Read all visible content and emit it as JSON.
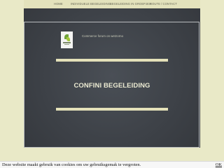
{
  "nav": {
    "items": [
      {
        "label": "HOME"
      },
      {
        "label": "INDIVIDUELE BEGELEIDING"
      },
      {
        "label": "BEGELEIDING IN GROEPJES"
      },
      {
        "label": "ROUTE / CONTACT"
      }
    ]
  },
  "hero": {
    "tagline": "Commerce forum on wetzorno",
    "title": "CONFINI BEGELEIDING"
  },
  "cookie": {
    "text": "Deze website maakt gebruik van cookies om uw gebruiksgemak te vergroten.",
    "ok_label": "OK"
  },
  "colors": {
    "cream": "#e9e9c7",
    "chalkboard": "#3e4248",
    "accent_green": "#6fa339"
  }
}
